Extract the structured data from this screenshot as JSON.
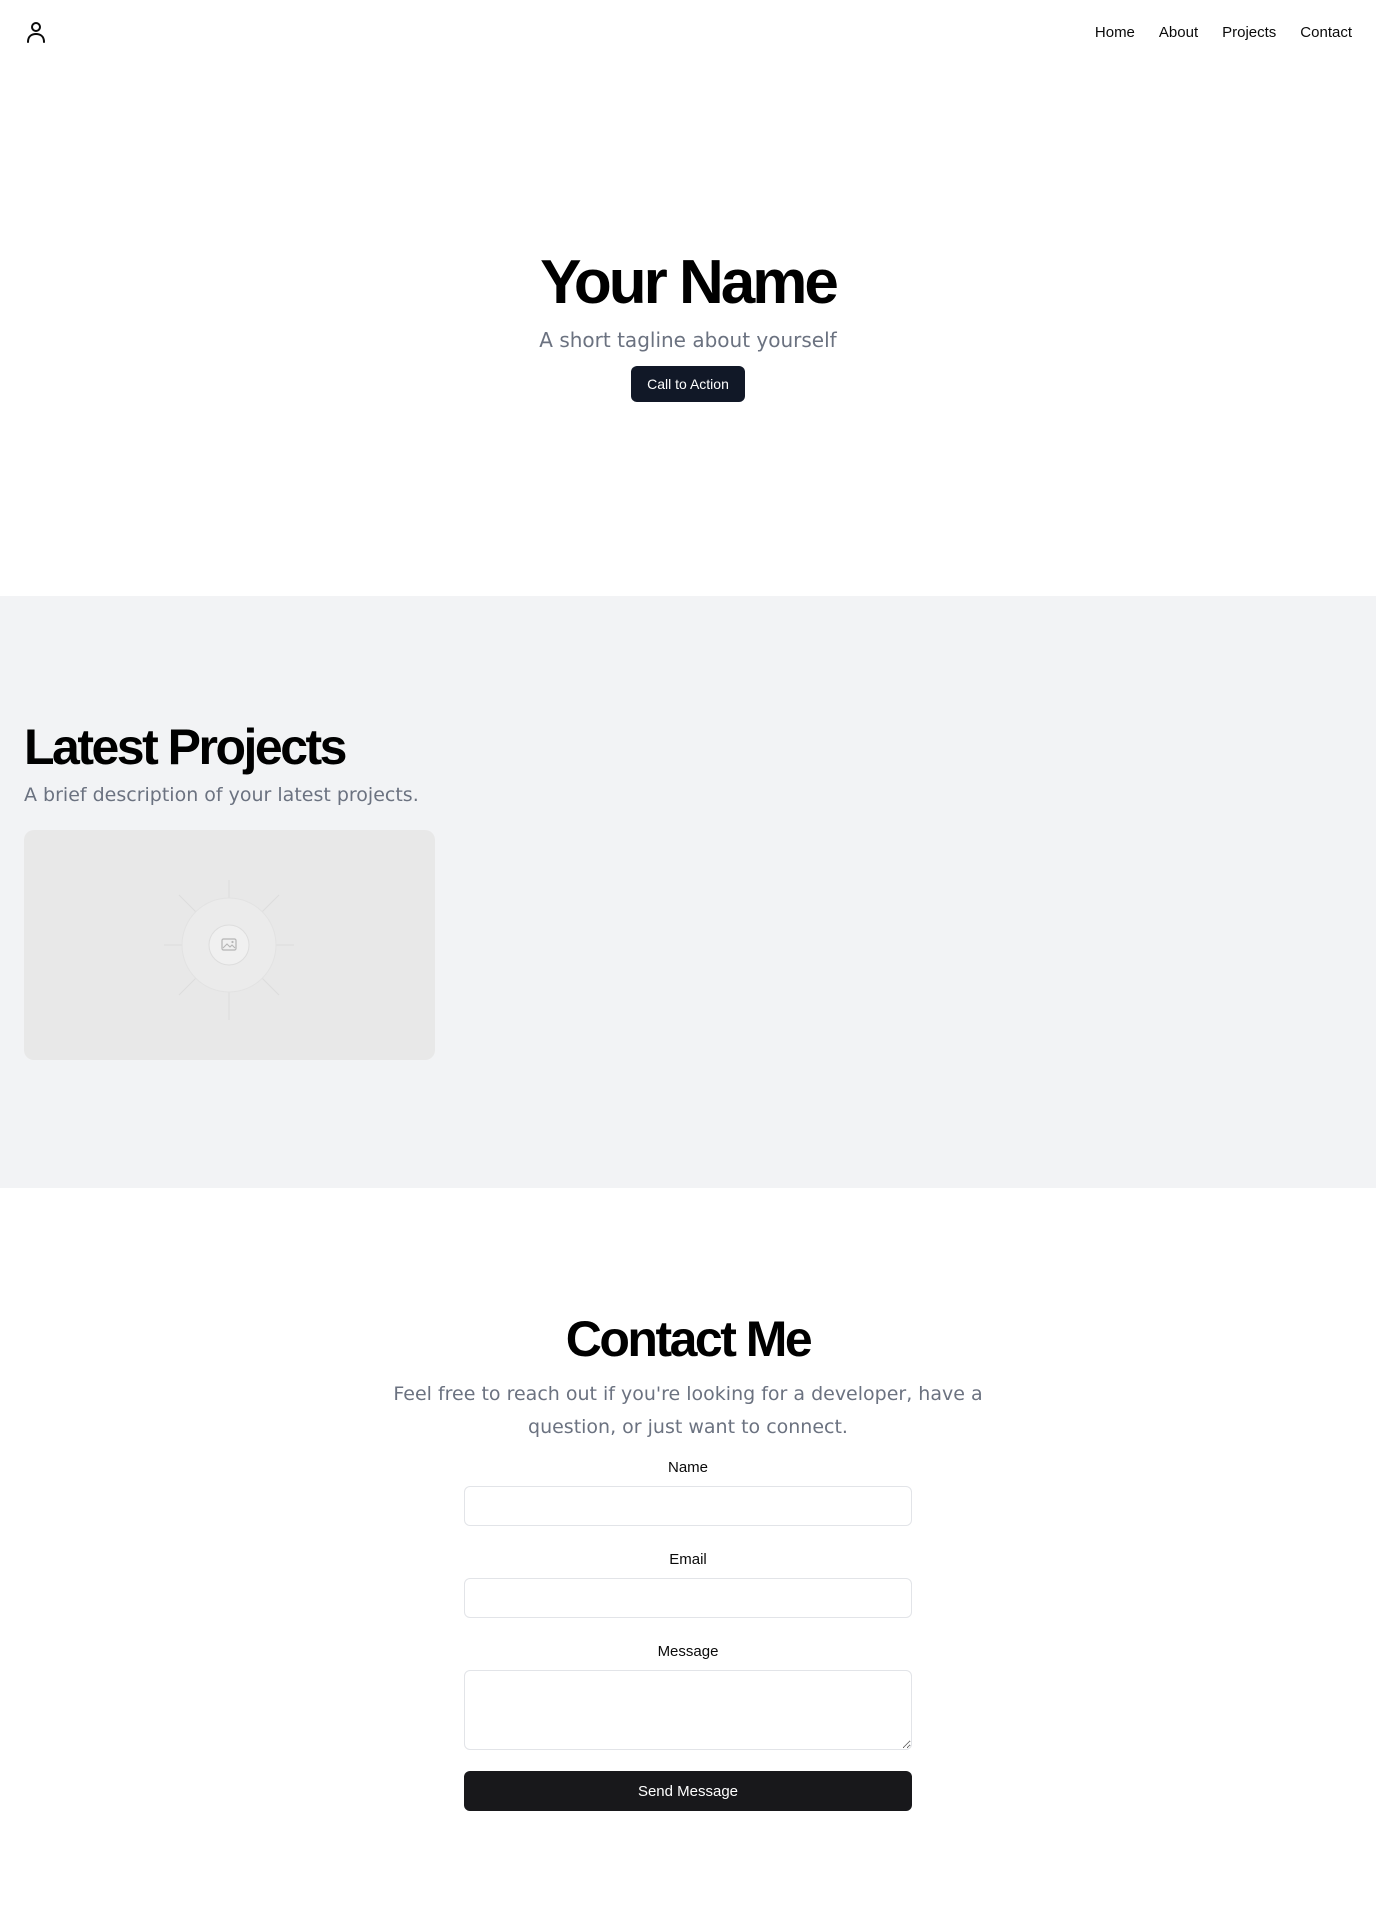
{
  "header": {
    "logo_icon": "user-icon",
    "nav": [
      "Home",
      "About",
      "Projects",
      "Contact"
    ]
  },
  "hero": {
    "title": "Your Name",
    "tagline": "A short tagline about yourself",
    "cta_label": "Call to Action"
  },
  "projects": {
    "title": "Latest Projects",
    "description": "A brief description of your latest projects.",
    "card_icon": "image-placeholder-icon"
  },
  "contact": {
    "title": "Contact Me",
    "intro": "Feel free to reach out if you're looking for a developer, have a question, or just want to connect.",
    "fields": {
      "name_label": "Name",
      "email_label": "Email",
      "message_label": "Message"
    },
    "send_label": "Send Message"
  },
  "colors": {
    "primary_button": "#111827",
    "send_button": "#18181b",
    "muted_text": "#6b7280",
    "section_bg": "#f2f3f5"
  }
}
